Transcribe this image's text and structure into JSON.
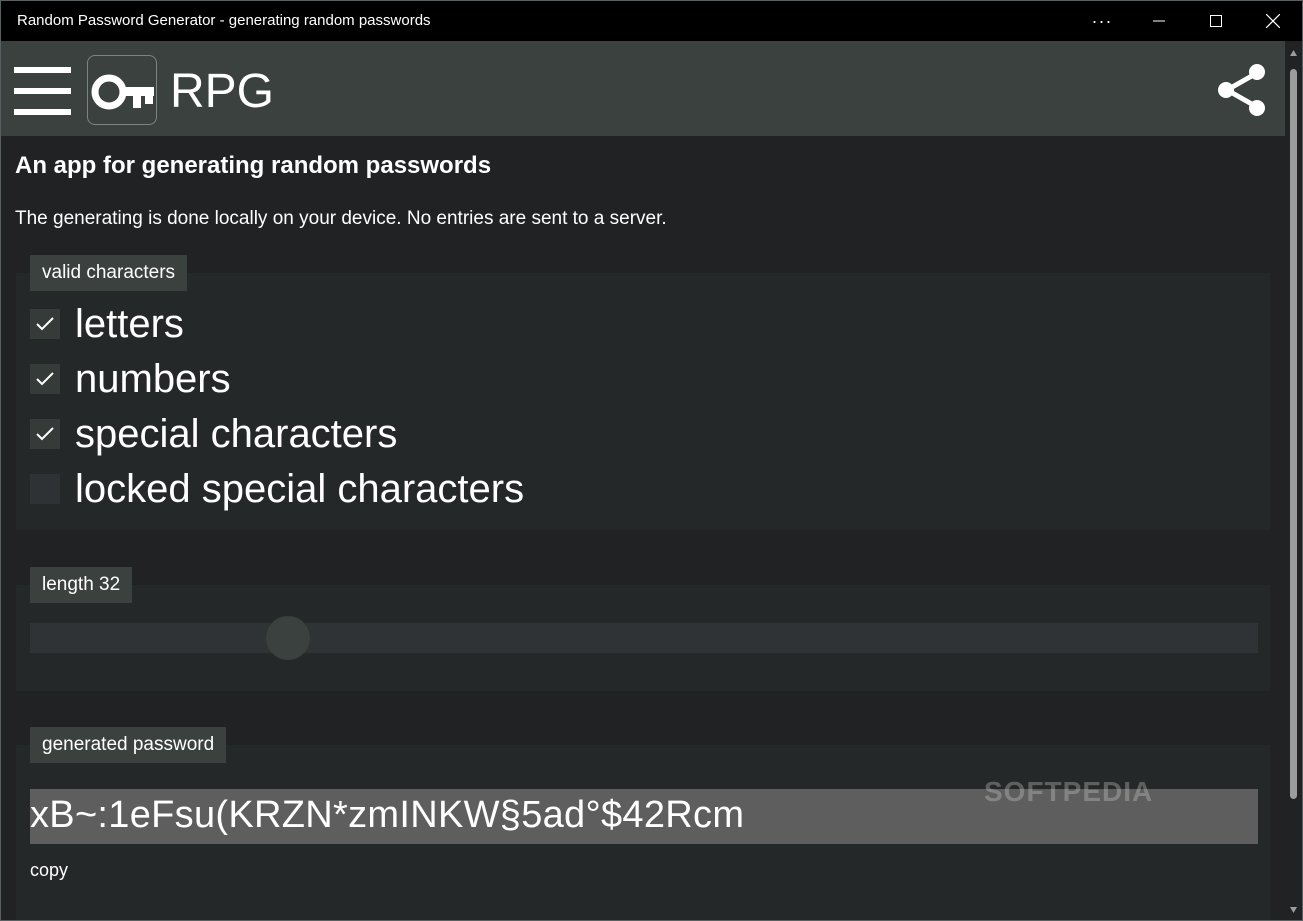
{
  "window": {
    "title": "Random Password Generator - generating random passwords",
    "more_glyph": "···"
  },
  "appbar": {
    "title": "RPG",
    "menu_icon": "hamburger-menu-icon",
    "logo_icon": "key-icon",
    "share_icon": "share-icon"
  },
  "intro": {
    "heading": "An app for generating random passwords",
    "text": "The generating is done locally on your device. No entries are sent to a server."
  },
  "valid_characters": {
    "legend": "valid characters",
    "options": [
      {
        "label": "letters",
        "checked": true
      },
      {
        "label": "numbers",
        "checked": true
      },
      {
        "label": "special characters",
        "checked": true
      },
      {
        "label": "locked special characters",
        "checked": false
      }
    ]
  },
  "length": {
    "legend": "length 32",
    "slider_fraction": 0.21
  },
  "generated": {
    "legend": "generated password",
    "password": "xB~:1eFsu(KRZN*zmINKW§5ad°$42Rcm",
    "copy_label": "copy"
  },
  "watermark": "SOFTPEDIA",
  "colors": {
    "appbar": "#3a413e",
    "background": "#202224",
    "panel": "#252829",
    "password_field": "#5e5e5e"
  }
}
